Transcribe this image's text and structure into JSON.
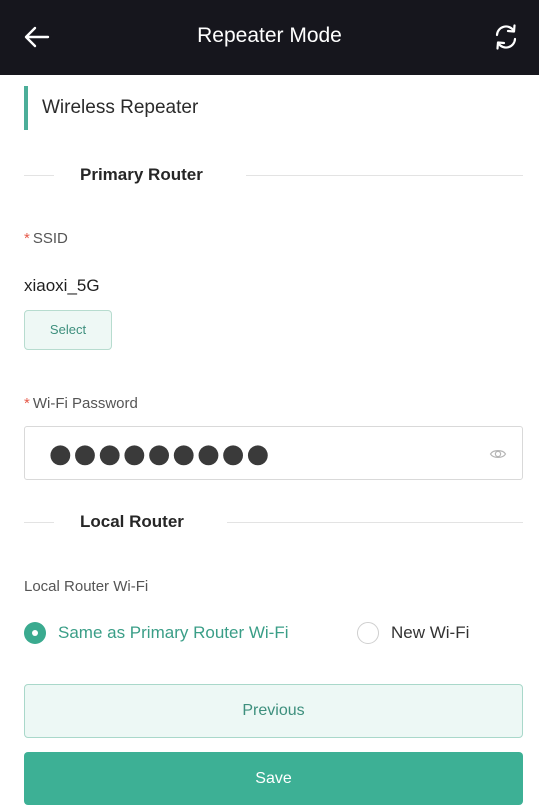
{
  "header": {
    "title": "Repeater Mode",
    "back_icon": "arrow-left-icon",
    "refresh_icon": "refresh-icon"
  },
  "section": {
    "title": "Wireless Repeater"
  },
  "primary_router": {
    "heading": "Primary Router",
    "ssid_required_mark": "*",
    "ssid_label": "SSID",
    "ssid_value": "xiaoxi_5G",
    "select_label": "Select",
    "password_required_mark": "*",
    "password_label": "Wi-Fi Password",
    "password_value": "●●●●●●●●●",
    "eye_icon": "eye-icon"
  },
  "local_router": {
    "heading": "Local Router",
    "wifi_label": "Local Router Wi-Fi",
    "options": [
      {
        "label": "Same as Primary Router Wi-Fi",
        "selected": true
      },
      {
        "label": "New Wi-Fi",
        "selected": false
      }
    ]
  },
  "actions": {
    "previous_label": "Previous",
    "save_label": "Save"
  },
  "colors": {
    "header_bg": "#16161d",
    "accent": "#3db095",
    "required": "#e65a4a"
  }
}
